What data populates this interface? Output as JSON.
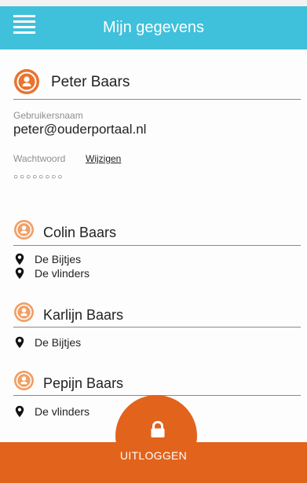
{
  "header": {
    "title": "Mijn gegevens",
    "menu_icon": "hamburger-menu-icon"
  },
  "user": {
    "name": "Peter Baars",
    "avatar_icon": "user-avatar-icon",
    "username_label": "Gebruikersnaam",
    "username": "peter@ouderportaal.nl",
    "password_label": "Wachtwoord",
    "change_password_label": "Wijzigen",
    "password_mask": "○○○○○○○○"
  },
  "children": [
    {
      "name": "Colin Baars",
      "locations": [
        "De Bijtjes",
        "De vlinders"
      ]
    },
    {
      "name": "Karlijn Baars",
      "locations": [
        "De Bijtjes"
      ]
    },
    {
      "name": "Pepijn Baars",
      "locations": [
        "De vlinders"
      ]
    }
  ],
  "footer": {
    "logout_label": "UITLOGGEN",
    "lock_icon": "lock-icon"
  },
  "colors": {
    "header": "#3fc0db",
    "accent": "#e2631c",
    "child_avatar": "#f0a066",
    "user_avatar": "#e8732f"
  }
}
